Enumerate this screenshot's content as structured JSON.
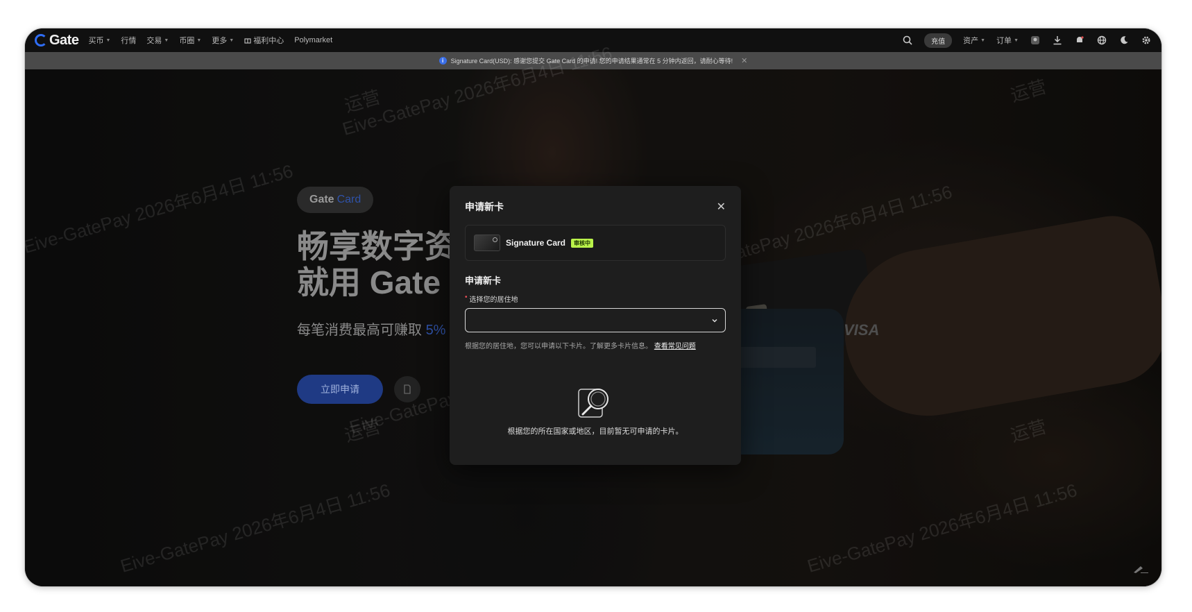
{
  "topnav": {
    "logo": "Gate",
    "items": [
      {
        "label": "买币",
        "has_caret": true
      },
      {
        "label": "行情",
        "has_caret": false
      },
      {
        "label": "交易",
        "has_caret": true
      },
      {
        "label": "币圈",
        "has_caret": true
      },
      {
        "label": "更多",
        "has_caret": true
      },
      {
        "label": "福利中心",
        "has_caret": false
      },
      {
        "label": "Polymarket",
        "has_caret": false
      }
    ],
    "deposit_label": "充值",
    "assets_label": "资产",
    "orders_label": "订单",
    "icons": [
      "search-icon",
      "avatar-icon",
      "download-icon",
      "bell-icon",
      "globe-icon",
      "moon-icon",
      "gear-icon"
    ]
  },
  "banner": {
    "text": "Signature Card(USD): 感谢您提交 Gate Card 的申请! 您的申请结果通常在 5 分钟内返回，请耐心等待!"
  },
  "hero": {
    "badge_brand": "Gate",
    "badge_product": "Card",
    "title_line1": "畅享数字资",
    "title_line2": "就用 Gate",
    "subtitle": "每笔消费最高可赚取 ",
    "subtitle_highlight": "5%",
    "apply_label": "立即申请",
    "visa_text": "VISA"
  },
  "watermarks": [
    "Eive-GatePay 2026年6月4日 11:56",
    "运营"
  ],
  "modal": {
    "title": "申请新卡",
    "card_name": "Signature Card",
    "card_status": "审核中",
    "section_title": "申请新卡",
    "field_label": "选择您的居住地",
    "field_value": "",
    "hint_text": "根据您的居住地，您可以申请以下卡片。了解更多卡片信息。",
    "hint_link": "查看常见问题",
    "empty_text": "根据您的所在国家或地区，目前暂无可申请的卡片。"
  },
  "colors": {
    "accent": "#2f6df6",
    "status_badge": "#b9f24a",
    "modal_bg": "#1e1e1e"
  }
}
